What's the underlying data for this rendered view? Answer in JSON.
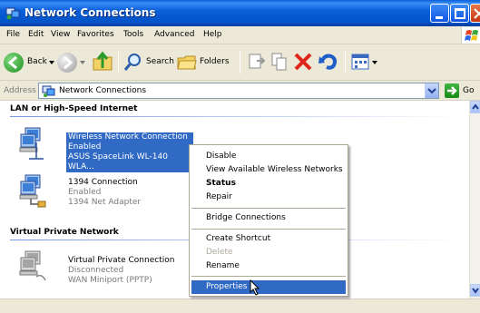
{
  "window": {
    "title": "Network Connections"
  },
  "menubar": {
    "items": [
      "File",
      "Edit",
      "View",
      "Favorites",
      "Tools",
      "Advanced",
      "Help"
    ]
  },
  "toolbar": {
    "back_label": "Back",
    "search_label": "Search",
    "folders_label": "Folders"
  },
  "address": {
    "label": "Address",
    "value": "Network Connections",
    "go_label": "Go"
  },
  "groups": {
    "lan": {
      "heading": "LAN or High-Speed Internet",
      "connections": [
        {
          "name": "Wireless Network Connection",
          "status": "Enabled",
          "device": "ASUS SpaceLink WL-140 WLA...",
          "selected": true
        },
        {
          "name": "1394 Connection",
          "status": "Enabled",
          "device": "1394 Net Adapter",
          "selected": false
        }
      ]
    },
    "vpn": {
      "heading": "Virtual Private Network",
      "connections": [
        {
          "name": "Virtual Private Connection",
          "status": "Disconnected",
          "device": "WAN Miniport (PPTP)",
          "selected": false
        }
      ]
    }
  },
  "context_menu": {
    "items": [
      {
        "label": "Disable",
        "state": "normal"
      },
      {
        "label": "View Available Wireless Networks",
        "state": "normal"
      },
      {
        "label": "Status",
        "state": "bold"
      },
      {
        "label": "Repair",
        "state": "normal"
      },
      {
        "label": "Bridge Connections",
        "state": "normal"
      },
      {
        "label": "Create Shortcut",
        "state": "normal"
      },
      {
        "label": "Delete",
        "state": "disabled"
      },
      {
        "label": "Rename",
        "state": "normal"
      },
      {
        "label": "Properties",
        "state": "highlighted"
      }
    ]
  },
  "colors": {
    "titlebar": "#0a5fd8",
    "selection": "#316ac5",
    "chrome": "#ece9d8"
  },
  "icons": [
    "network-connections-icon",
    "back-icon",
    "forward-icon",
    "up-folder-icon",
    "search-icon",
    "folders-icon",
    "move-to-icon",
    "copy-to-icon",
    "delete-icon",
    "undo-icon",
    "views-icon",
    "go-icon",
    "windows-logo-icon",
    "network-computer-icon",
    "mouse-cursor-icon"
  ]
}
